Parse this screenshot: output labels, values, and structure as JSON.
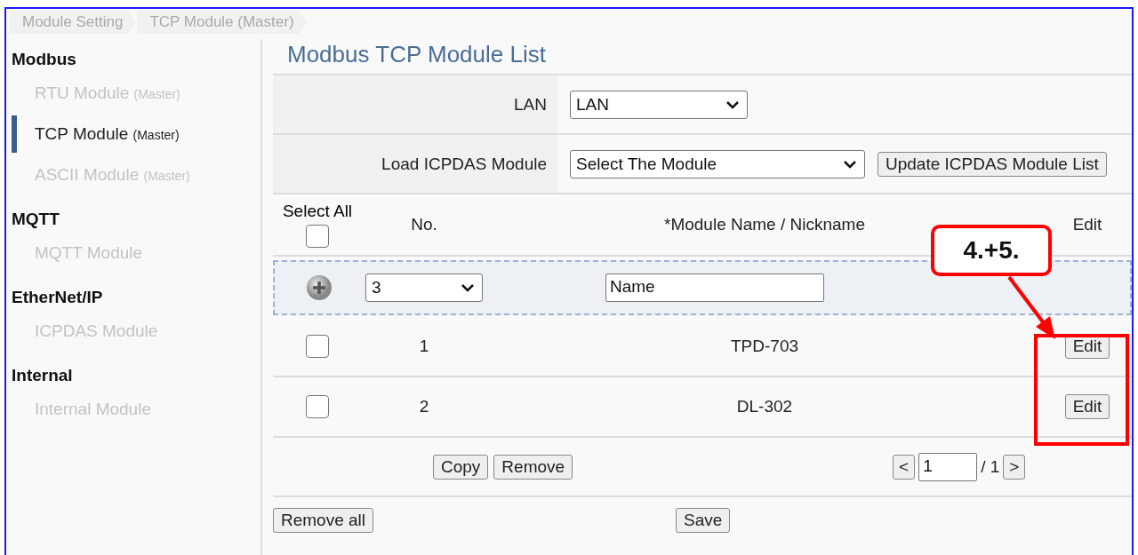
{
  "breadcrumb": [
    "Module Setting",
    "TCP Module (Master)"
  ],
  "sidebar": {
    "groups": [
      {
        "title": "Modbus",
        "items": [
          {
            "label": "RTU Module",
            "suffix": "(Master)",
            "selected": false
          },
          {
            "label": "TCP Module",
            "suffix": "(Master)",
            "selected": true
          },
          {
            "label": "ASCII Module",
            "suffix": "(Master)",
            "selected": false
          }
        ]
      },
      {
        "title": "MQTT",
        "items": [
          {
            "label": "MQTT Module",
            "selected": false
          }
        ]
      },
      {
        "title": "EtherNet/IP",
        "items": [
          {
            "label": "ICPDAS Module",
            "selected": false
          }
        ]
      },
      {
        "title": "Internal",
        "items": [
          {
            "label": "Internal Module",
            "selected": false
          }
        ]
      }
    ]
  },
  "main": {
    "title": "Modbus TCP Module List",
    "lan": {
      "label": "LAN",
      "value": "LAN"
    },
    "load": {
      "label": "Load ICPDAS Module",
      "value": "Select The Module",
      "button": "Update ICPDAS Module List"
    },
    "table": {
      "columns": [
        "Select All",
        "No.",
        "*Module Name / Nickname",
        "Edit"
      ],
      "select_all_checked": false,
      "new_row": {
        "number": "3",
        "name": "Name"
      },
      "rows": [
        {
          "checked": false,
          "no": "1",
          "name": "TPD-703",
          "edit": "Edit"
        },
        {
          "checked": false,
          "no": "2",
          "name": "DL-302",
          "edit": "Edit"
        }
      ]
    },
    "actions": [
      "Copy",
      "Remove"
    ],
    "pager": {
      "prev": "<",
      "page": "1",
      "total": "/ 1",
      "next": ">"
    },
    "bottom": [
      "Remove all",
      "Save"
    ]
  },
  "annotation": {
    "callout": "4.+5."
  }
}
